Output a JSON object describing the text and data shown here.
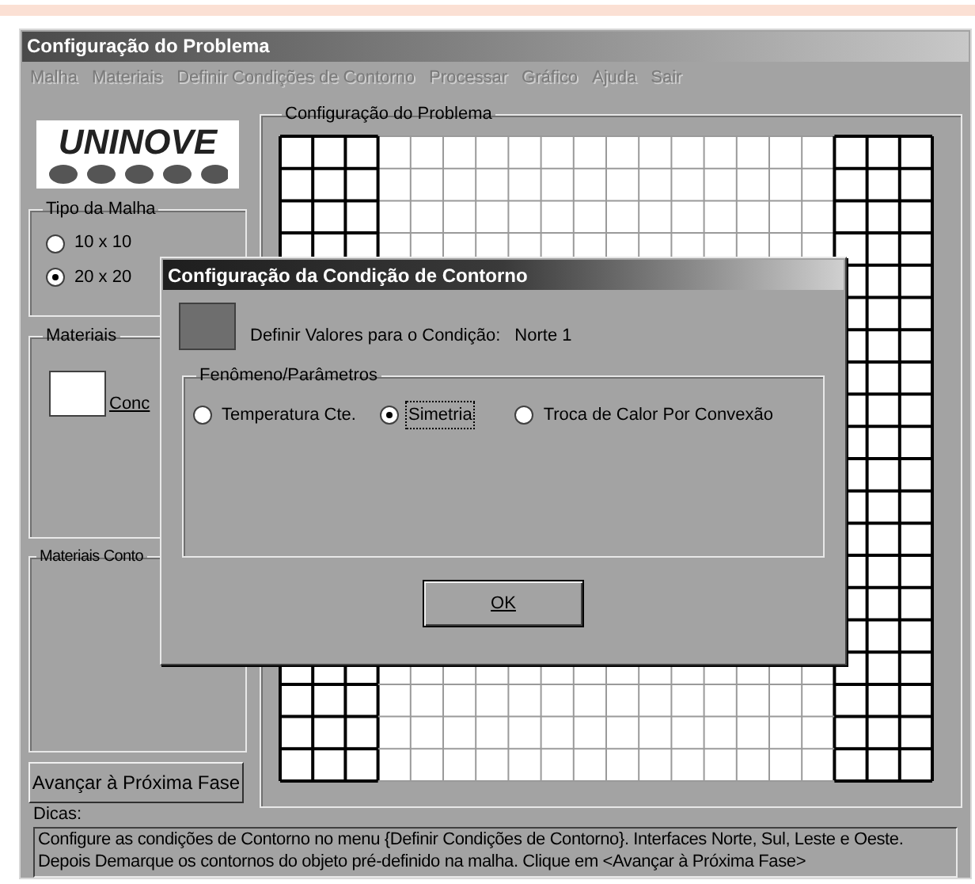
{
  "window": {
    "title": "Configuração do Problema"
  },
  "menu": [
    {
      "label": "Malha",
      "disabled": true
    },
    {
      "label": "Materiais",
      "disabled": true
    },
    {
      "label": "Definir Condições de Contorno",
      "disabled": true
    },
    {
      "label": "Processar",
      "disabled": true
    },
    {
      "label": "Gráfico",
      "disabled": true
    },
    {
      "label": "Ajuda",
      "disabled": true
    },
    {
      "label": "Sair",
      "disabled": true
    }
  ],
  "logo": {
    "text": "UNINOVE"
  },
  "mesh_type": {
    "title": "Tipo da Malha",
    "options": [
      {
        "label": "10 x 10",
        "selected": false
      },
      {
        "label": "20 x 20",
        "selected": true
      }
    ]
  },
  "materials": {
    "title": "Materiais",
    "item_label": "Conc"
  },
  "boundary_materials": {
    "title": "Materiais Conto"
  },
  "advance_button": "Avançar à Próxima Fase",
  "problem_group": {
    "title": "Configuração do Problema"
  },
  "hints": {
    "label": "Dicas:",
    "lines": [
      "Configure as condições de Contorno no menu {Definir Condições de Contorno}. Interfaces Norte, Sul, Leste e Oeste.",
      "Depois Demarque os contornos do objeto pré-definido na malha. Clique em <Avançar à Próxima Fase>"
    ]
  },
  "dialog": {
    "title": "Configuração da Condição de Contorno",
    "prompt": "Definir Valores para o Condição:",
    "condition": "Norte 1",
    "group_title": "Fenômeno/Parâmetros",
    "options": [
      {
        "label": "Temperatura Cte.",
        "selected": false
      },
      {
        "label": "Simetria",
        "selected": true
      },
      {
        "label": "Troca de Calor Por Convexão",
        "selected": false
      }
    ],
    "ok_button": "OK"
  }
}
